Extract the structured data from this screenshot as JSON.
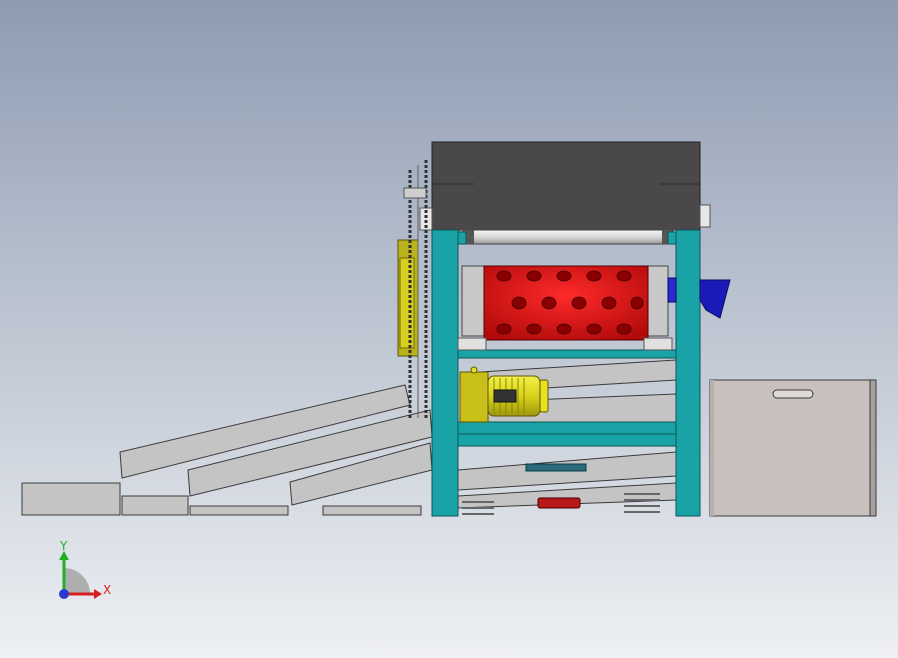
{
  "viewport": {
    "background_top": "#8e9cb2",
    "background_bottom": "#eef0f3"
  },
  "triad": {
    "x_label": "X",
    "y_label": "Y",
    "x_color": "#d42020",
    "y_color": "#1fb02a",
    "z_color": "#2a3ad0"
  },
  "colors": {
    "frame": "#1aa3a6",
    "hopper": "#4a484b",
    "drum": "#d81414",
    "motor": "#e8e21e",
    "chain": "#303030",
    "ramp": "#c4c4c4",
    "bin": "#c8c0bc",
    "chute": "#1a1ab8"
  }
}
